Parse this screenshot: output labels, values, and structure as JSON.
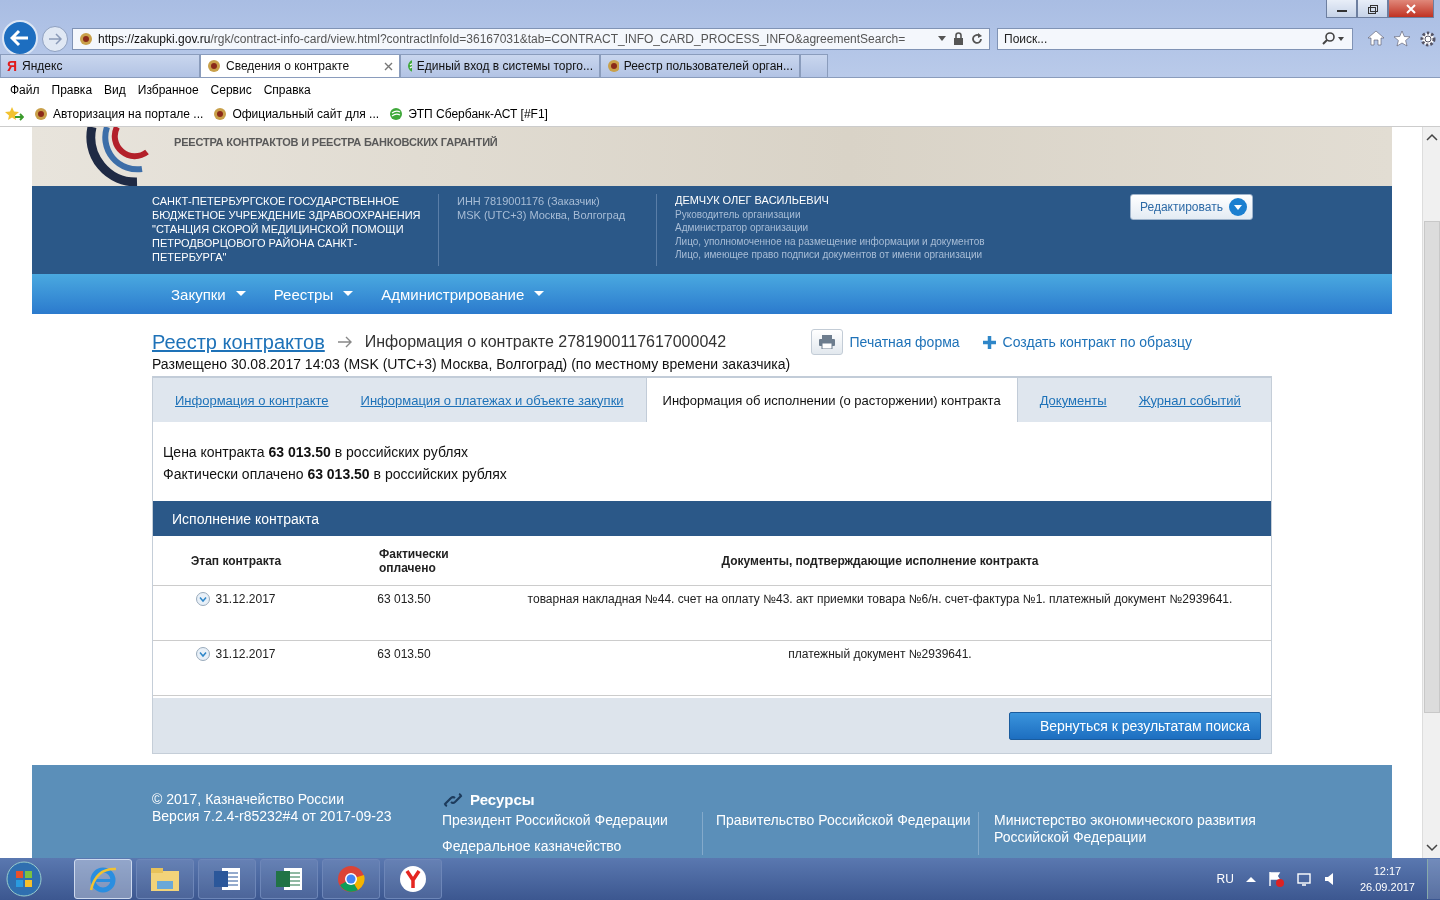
{
  "browser": {
    "url_host": "https://zakupki.gov.ru",
    "url_path": "/rgk/contract-info-card/view.html?contractInfoId=36167031&tab=CONTRACT_INFO_CARD_PROCESS_INFO&agreementSearch=",
    "search_placeholder": "Поиск...",
    "tabs": [
      {
        "label": "Яндекс",
        "glyph": "Я",
        "kind": "letter",
        "selected": false
      },
      {
        "label": "Сведения о контракте",
        "kind": "emblem",
        "selected": true
      },
      {
        "label": "Единый вход в системы торго...",
        "kind": "circle",
        "selected": false
      },
      {
        "label": "Реестр пользователей орган...",
        "kind": "emblem",
        "selected": false
      }
    ],
    "menu": [
      "Файл",
      "Правка",
      "Вид",
      "Избранное",
      "Сервис",
      "Справка"
    ],
    "favorites": [
      {
        "label": "Авторизация на портале ...",
        "kind": "emblem"
      },
      {
        "label": "Официальный сайт для ...",
        "kind": "emblem"
      },
      {
        "label": "ЭТП Сбербанк-АСТ [#F1]",
        "kind": "circle"
      }
    ]
  },
  "banner": {
    "subtitle": "РЕЕСТРА КОНТРАКТОВ И РЕЕСТРА БАНКОВСКИХ ГАРАНТИЙ"
  },
  "org": {
    "name": "САНКТ-ПЕТЕРБУРГСКОЕ ГОСУДАРСТВЕННОЕ БЮДЖЕТНОЕ УЧРЕЖДЕНИЕ ЗДРАВООХРАНЕНИЯ \"СТАНЦИЯ СКОРОЙ МЕДИЦИНСКОЙ ПОМОЩИ ПЕТРОДВОРЦОВОГО РАЙОНА САНКТ-ПЕТЕРБУРГА\"",
    "inn": "ИНН 7819001176 (Заказчик)",
    "timezone": "MSK (UTC+3) Москва, Волгоград",
    "person": "ДЕМЧУК ОЛЕГ ВАСИЛЬЕВИЧ",
    "roles": [
      "Руководитель организации",
      "Администратор организации",
      "Лицо, уполномоченное на размещение информации и документов",
      "Лицо, имеющее право подписи документов от имени организации"
    ],
    "edit_button": "Редактировать"
  },
  "nav": [
    "Закупки",
    "Реестры",
    "Администрирование"
  ],
  "breadcrumb": {
    "link": "Реестр контрактов",
    "current": "Информация о контракте 2781900117617000042"
  },
  "posted": "Размещено 30.08.2017 14:03 (MSK (UTC+3) Москва, Волгоград) (по местному времени заказчика)",
  "actions": {
    "print": "Печатная форма",
    "create": "Создать контракт по образцу"
  },
  "content_tabs": [
    {
      "label": "Информация о контракте",
      "selected": false
    },
    {
      "label": "Информация о платежах и объекте закупки",
      "selected": false
    },
    {
      "label": "Информация об исполнении (о расторжении) контракта",
      "selected": true
    },
    {
      "label": "Документы",
      "selected": false
    },
    {
      "label": "Журнал событий",
      "selected": false
    }
  ],
  "summary": [
    "Цена контракта **63 013.50** в российских рублях",
    "Фактически оплачено **63 013.50** в российских рублях"
  ],
  "execution": {
    "title": "Исполнение контракта",
    "columns": [
      "Этап контракта",
      "Фактически оплачено",
      "Документы, подтверждающие исполнение контракта"
    ],
    "rows": [
      {
        "stage": "31.12.2017",
        "paid": "63 013.50",
        "documents": "товарная накладная №44. счет на оплату №43. акт приемки товара №6/н. счет-фактура №1. платежный документ №2939641.",
        "expanded": false
      },
      {
        "stage": "31.12.2017",
        "paid": "63 013.50",
        "documents": "платежный документ №2939641.",
        "expanded": false
      }
    ],
    "back_button": "Вернуться к результатам поиска"
  },
  "footer": {
    "copyright": "© 2017, Казначейство России",
    "version": "Версия 7.2.4-r85232#4 от 2017-09-23",
    "resources_title": "Ресурсы",
    "links": [
      "Президент Российской Федерации",
      "Федеральное казначейство",
      "Правительство Российской Федерации",
      "Министерство экономического развития Российской Федерации"
    ]
  },
  "taskbar": {
    "apps": [
      {
        "kind": "ie",
        "selected": true
      },
      {
        "kind": "folder",
        "selected": false
      },
      {
        "kind": "word",
        "selected": false
      },
      {
        "kind": "excel",
        "selected": false
      },
      {
        "kind": "chrome",
        "selected": false
      },
      {
        "kind": "yandex",
        "selected": false
      }
    ],
    "lang": "RU",
    "time": "12:17",
    "date": "26.09.2017"
  }
}
